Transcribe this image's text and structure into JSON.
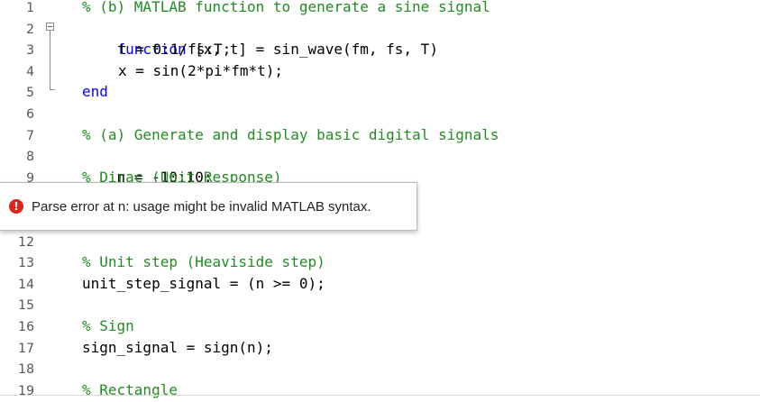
{
  "editor": {
    "line_numbers": [
      "1",
      "2",
      "3",
      "4",
      "5",
      "6",
      "7",
      "8",
      "9",
      "12",
      "13",
      "14",
      "15",
      "16",
      "17",
      "18",
      "19"
    ],
    "lines": {
      "l1_comment": "% (b) MATLAB function to generate a sine signal",
      "l2_keyword": "function",
      "l2_rest": " [x, t] = sin_wave(fm, fs, T)",
      "l3": "t = 0:1/fs:T;",
      "l4": "x = sin(2*pi*fm*t);",
      "l5_keyword": "end",
      "l7_comment": "% (a) Generate and display basic digital signals",
      "l8_var": "n",
      "l8_rest": " = -10:10;",
      "l9_comment": "% Dirac (Unit Response)",
      "l13_comment": "% Unit step (Heaviside step)",
      "l14": "unit_step_signal = (n >= 0);",
      "l16_comment": "% Sign",
      "l17": "sign_signal = sign(n);",
      "l19_comment": "% Rectangle"
    }
  },
  "tooltip": {
    "icon": "error-icon",
    "icon_glyph": "!",
    "message": "Parse error at n: usage might be invalid MATLAB syntax."
  }
}
